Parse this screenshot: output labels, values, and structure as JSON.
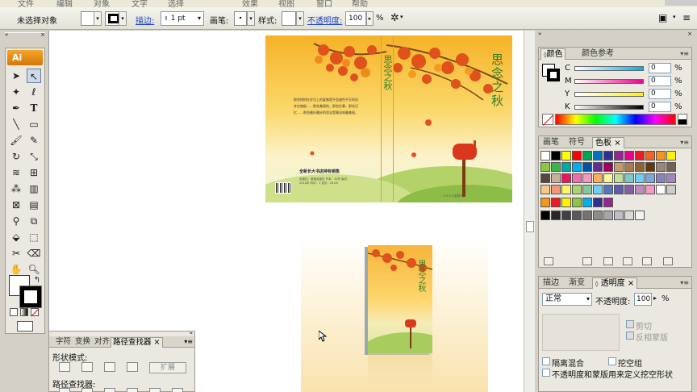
{
  "menubar": {
    "items": [
      "文件",
      "编辑",
      "对象",
      "文字",
      "选择",
      "效果",
      "视图",
      "窗口",
      "帮助"
    ]
  },
  "control_bar": {
    "selection_status": "未选择对象",
    "stroke_label": "描边:",
    "stroke_weight": "1 pt",
    "brush_label": "画笔:",
    "style_label": "样式:",
    "opacity_label": "不透明度:",
    "opacity_value": "100",
    "percent": "%"
  },
  "tools": {
    "logo": "Ai"
  },
  "cover": {
    "title": "思念之秋",
    "spine_title": "思念之秋",
    "back_paragraph": "那些悄悄在岁月上的爱像是不会褪色不灭的风并在燃起……那些美丽的，那些往事，那些记忆……那些最好最好的思念是最深刻最美丽。",
    "back_title": "全新长大书店持有销售",
    "back_info": "出版社：某某出版社  开本：32开  版次：2012年  印次：1  定价：25.00",
    "publisher": "××××出版社"
  },
  "book3d": {
    "title": "思念之秋"
  },
  "pathfinder_panel": {
    "tabs": [
      "字符",
      "变换",
      "对齐",
      "路径查找器"
    ],
    "active_tab": "路径查找器",
    "close": "×",
    "shape_mode_label": "形状模式:",
    "expand_label": "扩展",
    "pathfinders_label": "路径查找器:"
  },
  "color_panel": {
    "tabs": [
      "颜色",
      "颜色参考"
    ],
    "channels": [
      {
        "name": "C",
        "value": "0",
        "pct": "%"
      },
      {
        "name": "M",
        "value": "0",
        "pct": "%"
      },
      {
        "name": "Y",
        "value": "0",
        "pct": "%"
      },
      {
        "name": "K",
        "value": "0",
        "pct": "%"
      }
    ]
  },
  "swatches_panel": {
    "tabs": [
      "画笔",
      "符号",
      "色板"
    ],
    "active_tab": "色板",
    "row1": [
      "#ffffff",
      "#000000",
      "#ffff00",
      "#ff0000",
      "#00a651",
      "#0072bc",
      "#2e3192",
      "#92278f",
      "#ec008c",
      "#ed1c24",
      "#f26522",
      "#f7941d",
      "#fff200"
    ],
    "row2": [
      "#8dc63f",
      "#39b54a",
      "#00a99d",
      "#00aeef",
      "#0054a6",
      "#662d91",
      "#9e005d",
      "#c69c6d",
      "#a67c52",
      "#8c6239",
      "#603913",
      "#998675",
      "#736357"
    ],
    "row3": [
      "#534741",
      "#c7b299",
      "#ed145b",
      "#f06eaa",
      "#f49ac1",
      "#fbaf5d",
      "#fff799",
      "#c4df9b",
      "#7accc8",
      "#6dcff6",
      "#7da7d9",
      "#8781bd",
      "#a186be"
    ],
    "row4": [
      "#fdc689",
      "#f69679",
      "#fff568",
      "#acd373",
      "#82ca9c",
      "#6ecff6",
      "#5674b9",
      "#605ca8",
      "#855fa8",
      "#bd8cbf",
      "#f49ac2",
      "#ffffff",
      "#cccccc"
    ],
    "row5": [
      "#f7941d",
      "#ed1c24",
      "#fff200",
      "#8dc63f",
      "#00aeef",
      "#2e3192",
      "#92278f"
    ],
    "row6": [
      "#000000",
      "#262626",
      "#404040",
      "#595959",
      "#737373",
      "#8c8c8c",
      "#a6a6a6",
      "#bfbfbf",
      "#d9d9d9",
      "#f2f2f2"
    ]
  },
  "transparency_panel": {
    "tabs": [
      "描边",
      "渐变",
      "透明度"
    ],
    "active_tab": "透明度",
    "blend_mode": "正常",
    "opacity_label": "不透明度:",
    "opacity_value": "100",
    "percent": "%",
    "clip_label": "剪切",
    "invert_mask_label": "反相蒙版",
    "isolate_blending": "隔离混合",
    "knockout_group": "挖空组",
    "opacity_mask_define_knockout": "不透明度和蒙版用来定义挖空形状"
  }
}
